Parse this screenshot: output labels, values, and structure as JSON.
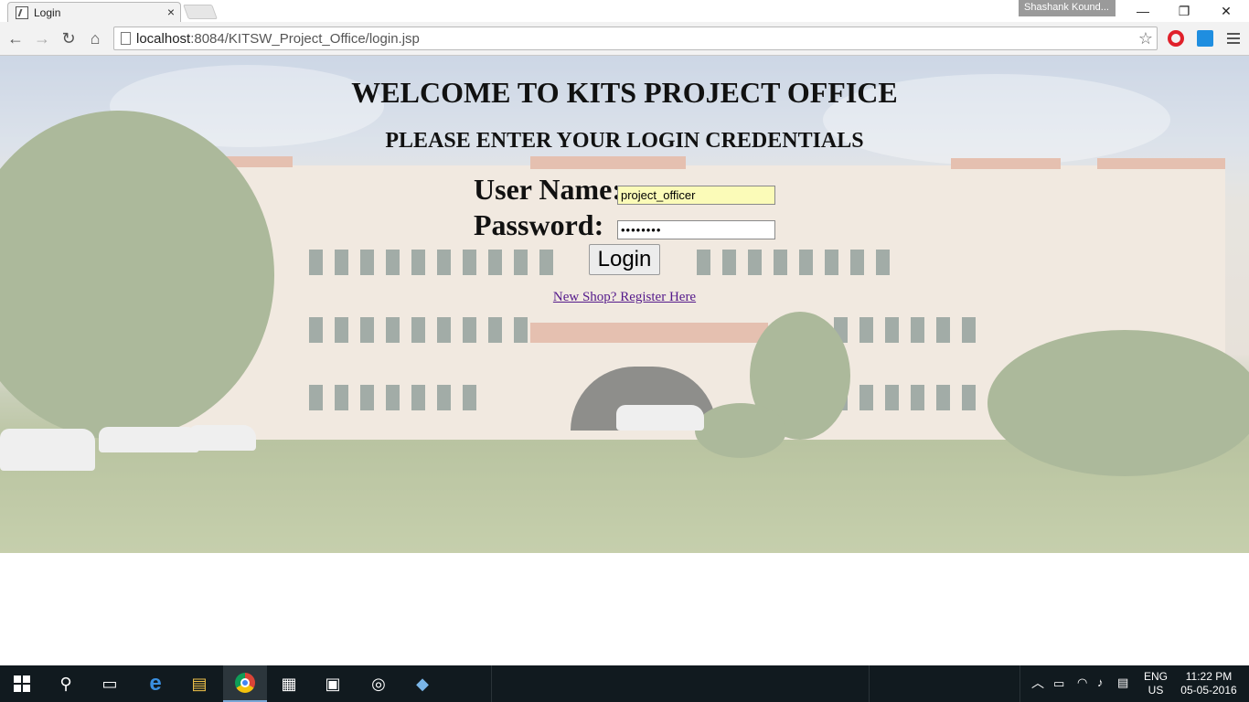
{
  "browser": {
    "tab_title": "Login",
    "tab_close": "×",
    "profile_name": "Shashank Kound...",
    "url_host": "localhost",
    "url_rest": ":8084/KITSW_Project_Office/login.jsp",
    "window_controls": {
      "minimize": "—",
      "restore": "❐",
      "close": "✕"
    },
    "nav_icons": {
      "back": "←",
      "forward": "→",
      "reload": "↻",
      "home": "⌂",
      "star": "☆"
    }
  },
  "page": {
    "heading": "WELCOME TO KITS PROJECT OFFICE",
    "subheading": "PLEASE ENTER YOUR LOGIN CREDENTIALS",
    "username_label": "User Name:",
    "username_value": "project_officer",
    "password_label": "Password:",
    "password_value": "••••••••",
    "login_button": "Login",
    "register_link": "New Shop? Register Here"
  },
  "taskbar": {
    "language": "ENG",
    "region": "US",
    "time": "11:22 PM",
    "date": "05-05-2016"
  }
}
